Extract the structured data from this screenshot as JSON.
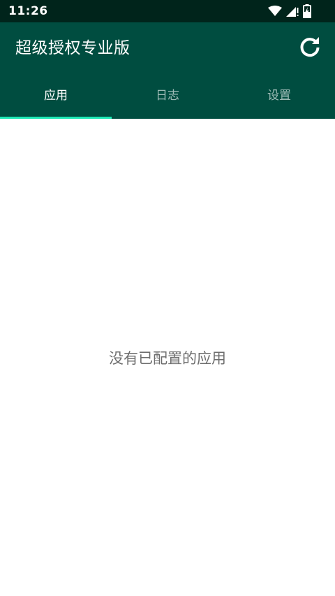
{
  "status_bar": {
    "time": "11:26",
    "icons": [
      "wifi-icon",
      "cellular-signal-icon",
      "battery-charging-icon"
    ]
  },
  "toolbar": {
    "title": "超级授权专业版",
    "refresh_icon": "refresh-icon"
  },
  "tabs": [
    {
      "label": "应用",
      "active": true
    },
    {
      "label": "日志",
      "active": false
    },
    {
      "label": "设置",
      "active": false
    }
  ],
  "content": {
    "empty_message": "没有已配置的应用"
  },
  "colors": {
    "status_bar": "#00241b",
    "app_bar": "#004d40",
    "tab_indicator": "#1de9b6",
    "empty_text": "#6d6d6d"
  }
}
